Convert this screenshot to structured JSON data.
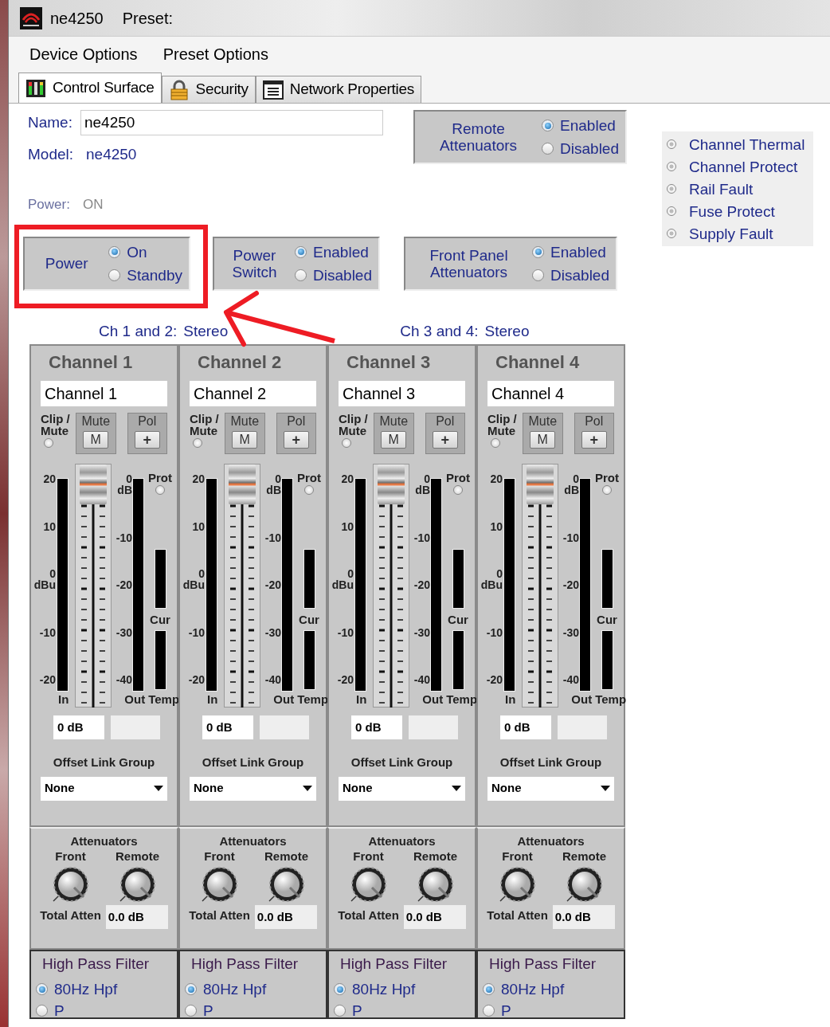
{
  "window": {
    "title": "ne4250",
    "preset_label": "Preset:"
  },
  "menu": [
    "Device Options",
    "Preset Options"
  ],
  "tabs": [
    {
      "label": "Control Surface",
      "selected": true
    },
    {
      "label": "Security",
      "selected": false
    },
    {
      "label": "Network Properties",
      "selected": false
    }
  ],
  "name_field": {
    "label": "Name:",
    "value": "ne4250"
  },
  "model": {
    "label": "Model:",
    "value": "ne4250"
  },
  "power_status": {
    "label": "Power:",
    "value": "ON"
  },
  "remote_attenuators": {
    "label": "Remote Attenuators",
    "options": [
      {
        "label": "Enabled",
        "selected": true
      },
      {
        "label": "Disabled",
        "selected": false
      }
    ]
  },
  "option_groups": [
    {
      "label": "Power",
      "options": [
        {
          "label": "On",
          "selected": true
        },
        {
          "label": "Standby",
          "selected": false
        }
      ]
    },
    {
      "label": "Power Switch",
      "options": [
        {
          "label": "Enabled",
          "selected": true
        },
        {
          "label": "Disabled",
          "selected": false
        }
      ]
    },
    {
      "label": "Front Panel Attenuators",
      "options": [
        {
          "label": "Enabled",
          "selected": true
        },
        {
          "label": "Disabled",
          "selected": false
        }
      ]
    }
  ],
  "faults": [
    "Channel Thermal",
    "Channel Protect",
    "Rail Fault",
    "Fuse Protect",
    "Supply Fault"
  ],
  "pairs": [
    {
      "label": "Ch 1 and 2:",
      "mode": "Stereo"
    },
    {
      "label": "Ch 3 and 4:",
      "mode": "Stereo"
    }
  ],
  "channels": [
    {
      "title": "Channel 1",
      "name": "Channel 1",
      "clip_mute": "Clip / Mute",
      "mute": "Mute",
      "mute_button": "M",
      "pol": "Pol",
      "pol_button": "+",
      "input_scale": [
        "20",
        "10",
        "0",
        "-10",
        "-20"
      ],
      "input_unit": "dBu",
      "output_scale": [
        "0",
        "-10",
        "-20",
        "-30",
        "-40"
      ],
      "output_unit": "dB",
      "prot": "Prot",
      "cur": "Cur",
      "in": "In",
      "out": "Out",
      "temp": "Temp",
      "fader": {
        "level": 1
      },
      "gain": "0 dB",
      "offset_title": "Offset Link Group",
      "offset_group": "None",
      "attenuators": "Attenuators",
      "front": "Front",
      "remote": "Remote",
      "total_atten_label": "Total Atten",
      "total_atten": "0.0 dB",
      "hpf_title": "High Pass Filter",
      "hpf_options": [
        {
          "label": "80Hz Hpf",
          "selected": true
        },
        {
          "label": "P",
          "selected": false
        }
      ]
    },
    {
      "title": "Channel 2",
      "name": "Channel 2",
      "clip_mute": "Clip / Mute",
      "mute": "Mute",
      "mute_button": "M",
      "pol": "Pol",
      "pol_button": "+",
      "input_scale": [
        "20",
        "10",
        "0",
        "-10",
        "-20"
      ],
      "input_unit": "dBu",
      "output_scale": [
        "0",
        "-10",
        "-20",
        "-30",
        "-40"
      ],
      "output_unit": "dB",
      "prot": "Prot",
      "cur": "Cur",
      "in": "In",
      "out": "Out",
      "temp": "Temp",
      "fader": {
        "level": 1
      },
      "gain": "0 dB",
      "offset_title": "Offset Link Group",
      "offset_group": "None",
      "attenuators": "Attenuators",
      "front": "Front",
      "remote": "Remote",
      "total_atten_label": "Total Atten",
      "total_atten": "0.0 dB",
      "hpf_title": "High Pass Filter",
      "hpf_options": [
        {
          "label": "80Hz Hpf",
          "selected": true
        },
        {
          "label": "P",
          "selected": false
        }
      ]
    },
    {
      "title": "Channel 3",
      "name": "Channel 3",
      "clip_mute": "Clip / Mute",
      "mute": "Mute",
      "mute_button": "M",
      "pol": "Pol",
      "pol_button": "+",
      "input_scale": [
        "20",
        "10",
        "0",
        "-10",
        "-20"
      ],
      "input_unit": "dBu",
      "output_scale": [
        "0",
        "-10",
        "-20",
        "-30",
        "-40"
      ],
      "output_unit": "dB",
      "prot": "Prot",
      "cur": "Cur",
      "in": "In",
      "out": "Out",
      "temp": "Temp",
      "fader": {
        "level": 1
      },
      "gain": "0 dB",
      "offset_title": "Offset Link Group",
      "offset_group": "None",
      "attenuators": "Attenuators",
      "front": "Front",
      "remote": "Remote",
      "total_atten_label": "Total Atten",
      "total_atten": "0.0 dB",
      "hpf_title": "High Pass Filter",
      "hpf_options": [
        {
          "label": "80Hz Hpf",
          "selected": true
        },
        {
          "label": "P",
          "selected": false
        }
      ]
    },
    {
      "title": "Channel 4",
      "name": "Channel 4",
      "clip_mute": "Clip / Mute",
      "mute": "Mute",
      "mute_button": "M",
      "pol": "Pol",
      "pol_button": "+",
      "input_scale": [
        "20",
        "10",
        "0",
        "-10",
        "-20"
      ],
      "input_unit": "dBu",
      "output_scale": [
        "0",
        "-10",
        "-20",
        "-30",
        "-40"
      ],
      "output_unit": "dB",
      "prot": "Prot",
      "cur": "Cur",
      "in": "In",
      "out": "Out",
      "temp": "Temp",
      "fader": {
        "level": 1
      },
      "gain": "0 dB",
      "offset_title": "Offset Link Group",
      "offset_group": "None",
      "attenuators": "Attenuators",
      "front": "Front",
      "remote": "Remote",
      "total_atten_label": "Total Atten",
      "total_atten": "0.0 dB",
      "hpf_title": "High Pass Filter",
      "hpf_options": [
        {
          "label": "80Hz Hpf",
          "selected": true
        },
        {
          "label": "P",
          "selected": false
        }
      ]
    }
  ]
}
